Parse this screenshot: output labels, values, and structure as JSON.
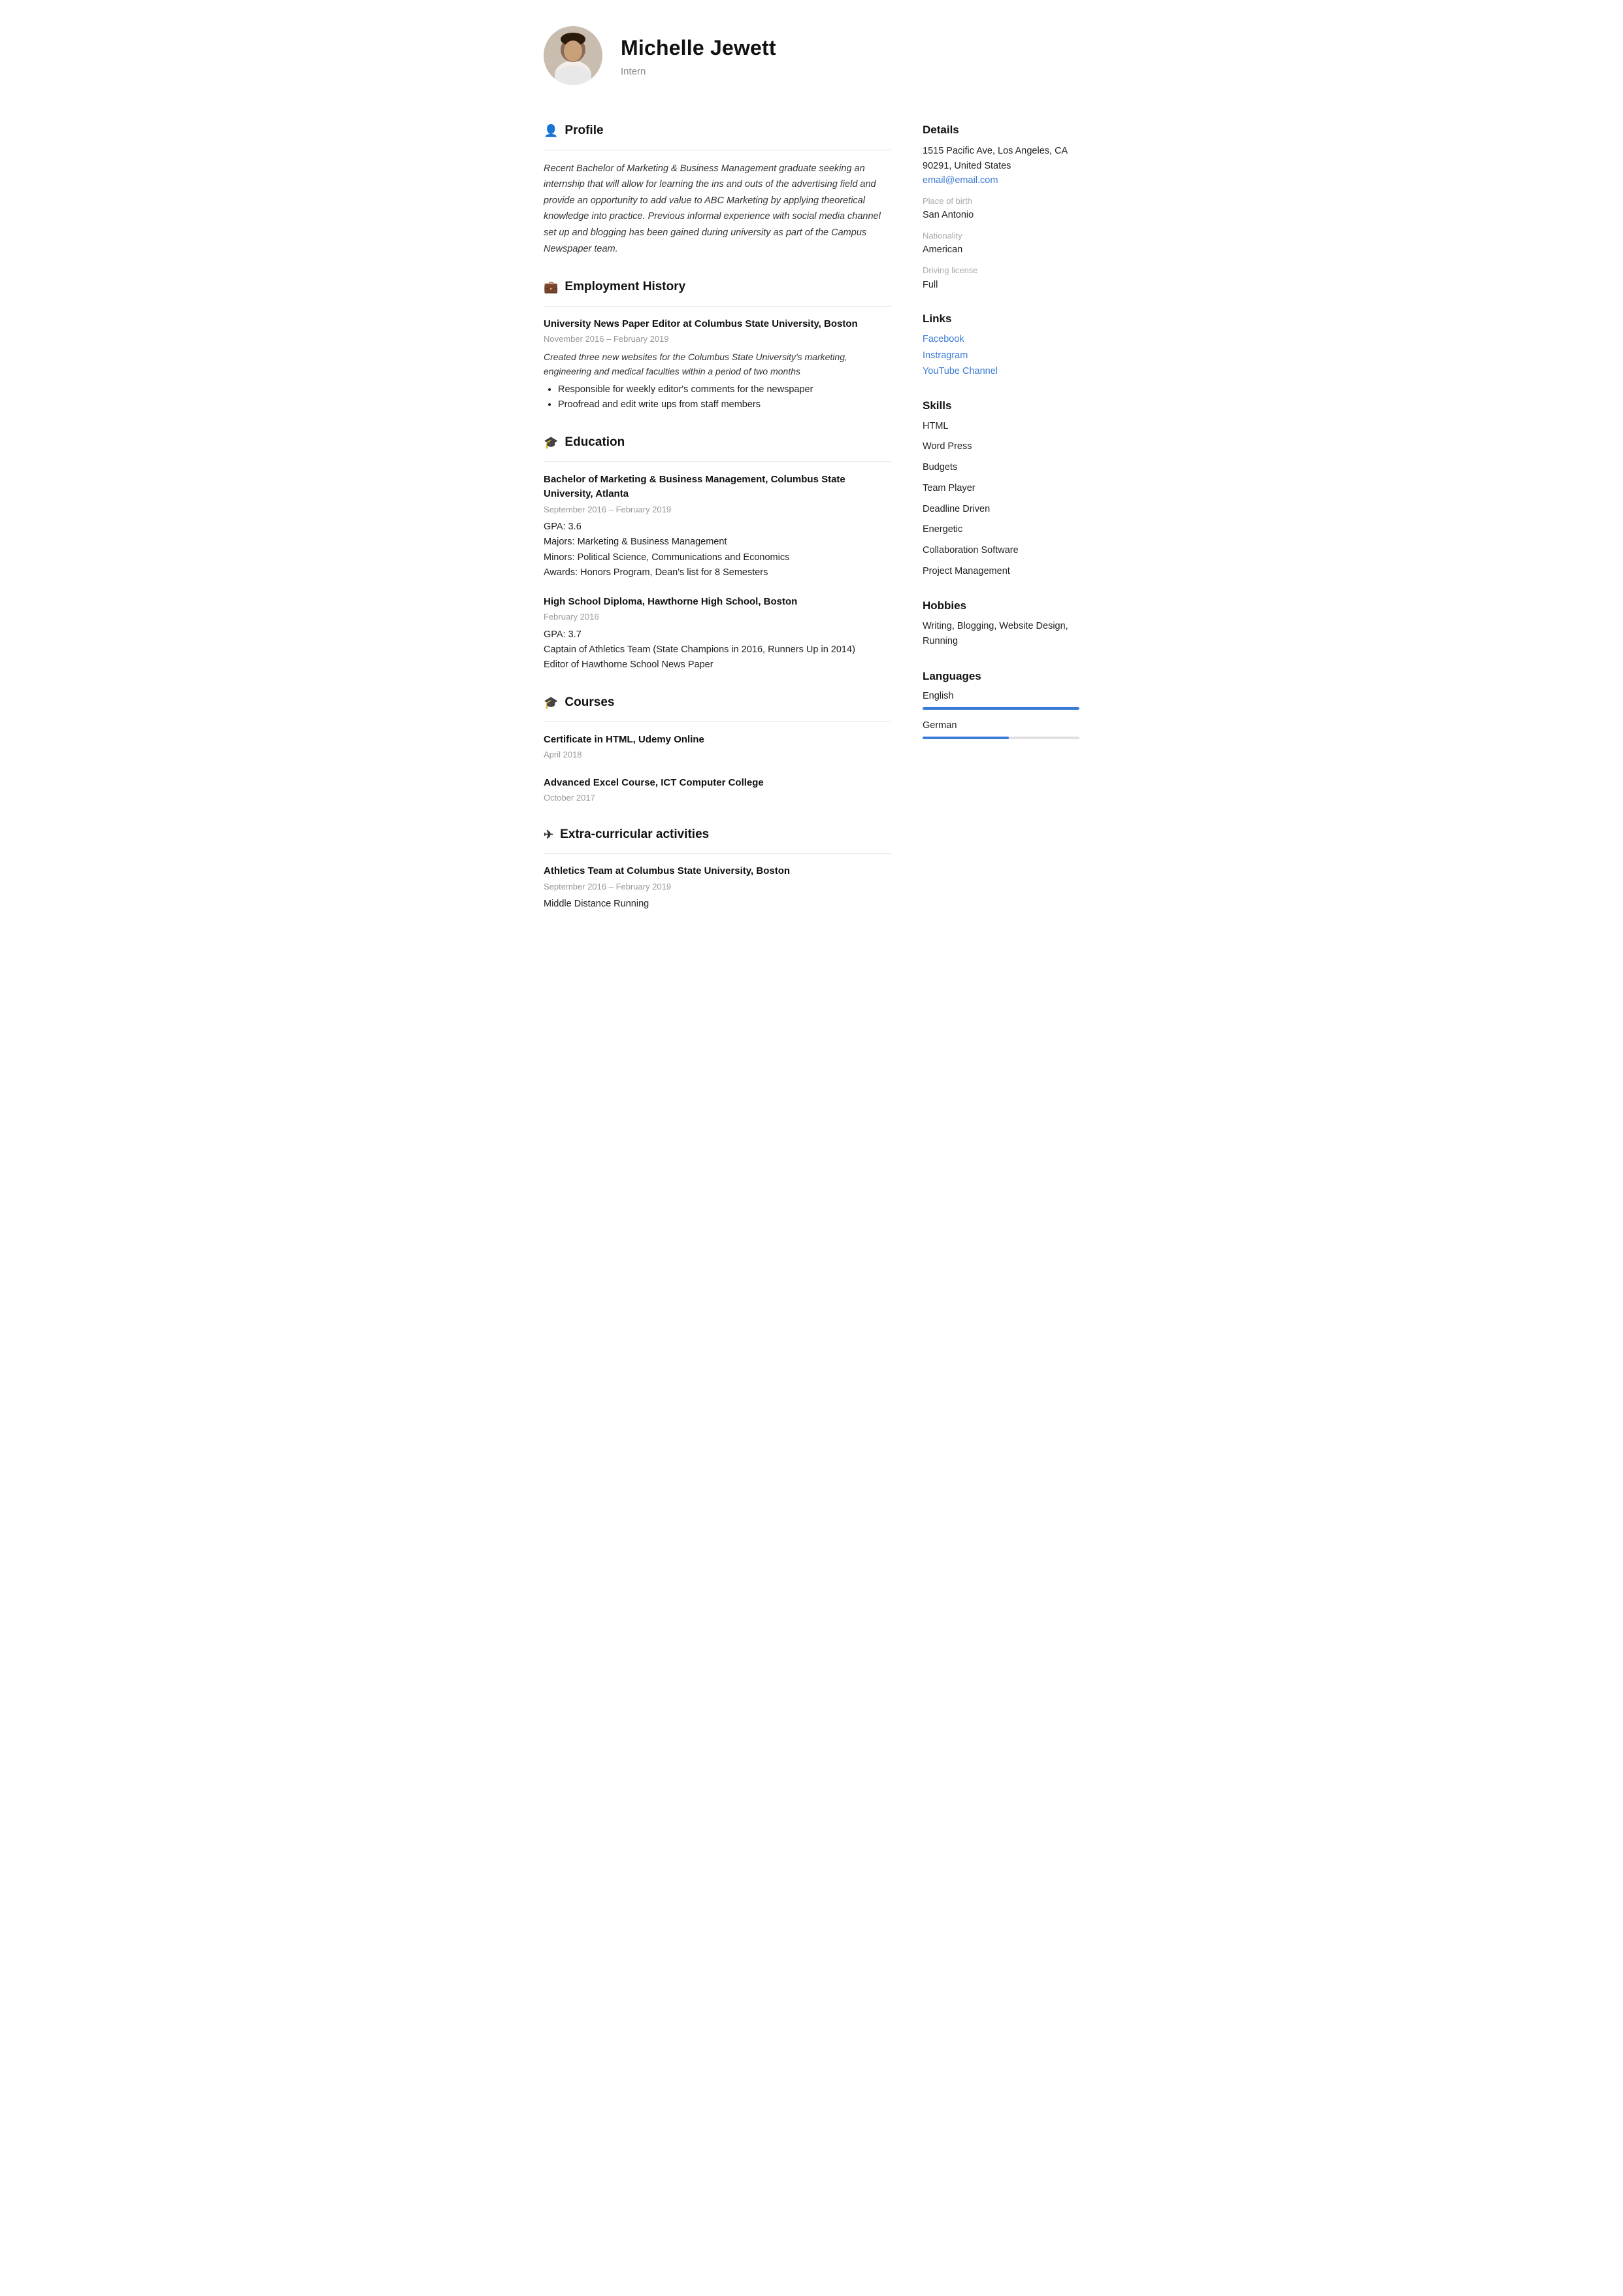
{
  "header": {
    "name": "Michelle Jewett",
    "subtitle": "Intern",
    "avatar_alt": "Michelle Jewett photo"
  },
  "sections": {
    "profile": {
      "title": "Profile",
      "icon": "👤",
      "text": "Recent Bachelor of Marketing & Business Management graduate seeking an internship that will allow for learning the ins and outs of the advertising field and provide an opportunity to add value to ABC Marketing by applying theoretical knowledge into practice. Previous informal experience with social media channel set up and blogging has been gained during university as part of the Campus Newspaper team."
    },
    "employment": {
      "title": "Employment History",
      "icon": "💼",
      "entries": [
        {
          "title": "University News Paper Editor at Columbus State University, Boston",
          "date": "November 2016 – February 2019",
          "desc": "Created three new websites for the Columbus State University's marketing, engineering and medical faculties within a period of two months",
          "bullets": [
            "Responsible for weekly editor's comments for the newspaper",
            "Proofread and edit write ups from staff members"
          ]
        }
      ]
    },
    "education": {
      "title": "Education",
      "icon": "🎓",
      "entries": [
        {
          "title": "Bachelor of Marketing & Business Management, Columbus State University, Atlanta",
          "date": "September 2016 – February 2019",
          "lines": [
            "GPA: 3.6",
            "Majors: Marketing & Business Management",
            "Minors: Political Science, Communications and Economics",
            "Awards: Honors Program, Dean's list for 8 Semesters"
          ]
        },
        {
          "title": "High School Diploma, Hawthorne High School, Boston",
          "date": "February 2016",
          "lines": [
            "GPA: 3.7",
            "Captain of Athletics Team (State Champions in 2016, Runners Up in 2014)",
            "Editor of Hawthorne School News Paper"
          ]
        }
      ]
    },
    "courses": {
      "title": "Courses",
      "icon": "🎓",
      "entries": [
        {
          "title": "Certificate in HTML, Udemy Online",
          "date": "April 2018"
        },
        {
          "title": "Advanced Excel Course, ICT Computer College",
          "date": "October 2017"
        }
      ]
    },
    "extracurricular": {
      "title": "Extra-curricular activities",
      "icon": "✈",
      "entries": [
        {
          "title": "Athletics Team at Columbus State University, Boston",
          "date": "September 2016 – February 2019",
          "lines": [
            "Middle Distance Running"
          ]
        }
      ]
    }
  },
  "sidebar": {
    "details": {
      "title": "Details",
      "address": "1515 Pacific Ave, Los Angeles, CA 90291, United States",
      "email": "email@email.com",
      "place_of_birth_label": "Place of birth",
      "place_of_birth": "San Antonio",
      "nationality_label": "Nationality",
      "nationality": "American",
      "driving_license_label": "Driving license",
      "driving_license": "Full"
    },
    "links": {
      "title": "Links",
      "items": [
        {
          "label": "Facebook",
          "url": "#"
        },
        {
          "label": "Instragram",
          "url": "#"
        },
        {
          "label": "YouTube Channel",
          "url": "#"
        }
      ]
    },
    "skills": {
      "title": "Skills",
      "items": [
        "HTML",
        "Word Press",
        "Budgets",
        "Team Player",
        "Deadline Driven",
        "Energetic",
        "Collaboration Software",
        "Project Management"
      ]
    },
    "hobbies": {
      "title": "Hobbies",
      "text": "Writing, Blogging, Website Design, Running"
    },
    "languages": {
      "title": "Languages",
      "items": [
        {
          "name": "English",
          "level": 100
        },
        {
          "name": "German",
          "level": 55
        }
      ]
    }
  }
}
